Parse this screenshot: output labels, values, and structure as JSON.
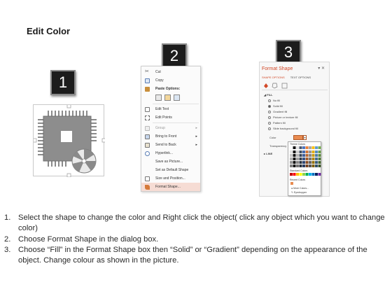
{
  "title": "Edit Color",
  "badges": [
    "1",
    "2",
    "3"
  ],
  "menu": {
    "items": [
      {
        "label": "Cut",
        "state": "normal"
      },
      {
        "label": "Copy",
        "state": "normal"
      },
      {
        "label": "Paste Options:",
        "state": "bold"
      },
      {
        "label": "Edit Text",
        "state": "normal"
      },
      {
        "label": "Edit Points",
        "state": "normal"
      },
      {
        "label": "Group",
        "state": "disabled"
      },
      {
        "label": "Bring to Front",
        "state": "normal"
      },
      {
        "label": "Send to Back",
        "state": "normal"
      },
      {
        "label": "Hyperlink...",
        "state": "normal"
      },
      {
        "label": "Save as Picture...",
        "state": "normal"
      },
      {
        "label": "Set as Default Shape",
        "state": "normal"
      },
      {
        "label": "Size and Position...",
        "state": "normal"
      },
      {
        "label": "Format Shape...",
        "state": "highlighted"
      }
    ]
  },
  "pane": {
    "title": "Format Shape",
    "tabs": [
      "SHAPE OPTIONS",
      "TEXT OPTIONS"
    ],
    "fill_section": "FILL",
    "fill_options": [
      "No fill",
      "Solid fill",
      "Gradient fill",
      "Picture or texture fill",
      "Pattern fill",
      "Slide background fill"
    ],
    "selected_fill": "Solid fill",
    "color_label": "Color",
    "transparency_label": "Transparency",
    "line_section": "LINE",
    "palette": {
      "theme_label": "Theme Colors",
      "standard_label": "Standard Colors",
      "recent_label": "Recent Colors",
      "more_colors": "More Colors...",
      "eyedropper": "Eyedropper",
      "accent": "#e98b50",
      "standard_colors": [
        "#c00000",
        "#ff0000",
        "#ffc000",
        "#ffff00",
        "#92d050",
        "#00b050",
        "#00b0f0",
        "#0070c0",
        "#002060",
        "#7030a0"
      ]
    }
  },
  "steps": [
    {
      "num": "1.",
      "text": "Select the shape to change the color and Right click the object( click any object which you want to change color)"
    },
    {
      "num": "2.",
      "text": "Choose Format Shape in the dialog box."
    },
    {
      "num": "3.",
      "text": "Choose “Fill” in the Format Shape box then “Solid” or “Gradient” depending on the appearance of the object. Change colour as shown in the picture."
    }
  ]
}
